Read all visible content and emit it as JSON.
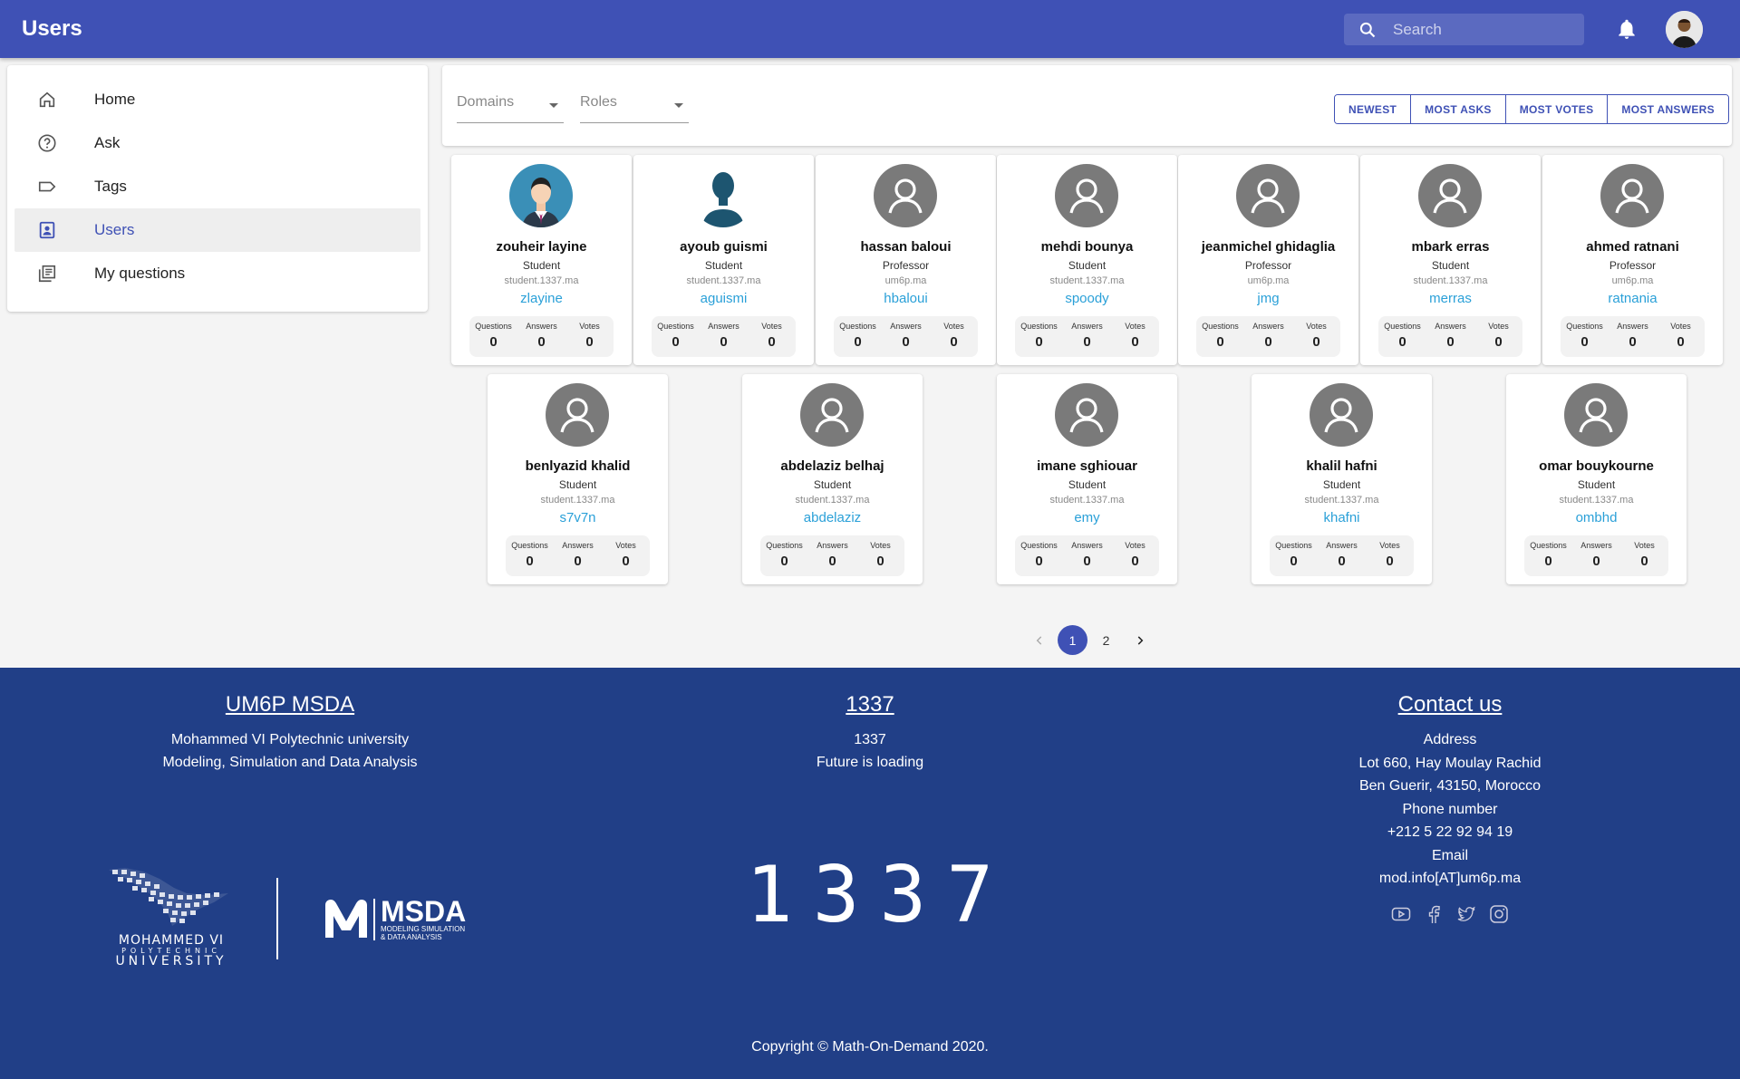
{
  "app": {
    "title": "Users"
  },
  "search": {
    "placeholder": "Search"
  },
  "sidebar": {
    "items": [
      {
        "label": "Home",
        "icon": "home-icon"
      },
      {
        "label": "Ask",
        "icon": "help-circle-icon"
      },
      {
        "label": "Tags",
        "icon": "label-icon"
      },
      {
        "label": "Users",
        "icon": "contact-card-icon",
        "active": true
      },
      {
        "label": "My questions",
        "icon": "library-books-icon"
      }
    ]
  },
  "filters": {
    "domains": "Domains",
    "roles": "Roles"
  },
  "sort": {
    "newest": "NEWEST",
    "most_asks": "MOST ASKS",
    "most_votes": "MOST VOTES",
    "most_answers": "MOST ANSWERS"
  },
  "stat_labels": {
    "questions": "Questions",
    "answers": "Answers",
    "votes": "Votes"
  },
  "users": [
    {
      "name": "zouheir layine",
      "role": "Student",
      "domain": "student.1337.ma",
      "username": "zlayine",
      "questions": "0",
      "answers": "0",
      "votes": "0",
      "avatar": "man-in-suit-avatar"
    },
    {
      "name": "ayoub guismi",
      "role": "Student",
      "domain": "student.1337.ma",
      "username": "aguismi",
      "questions": "0",
      "answers": "0",
      "votes": "0",
      "avatar": "person-silhouette-avatar"
    },
    {
      "name": "hassan baloui",
      "role": "Professor",
      "domain": "um6p.ma",
      "username": "hbaloui",
      "questions": "0",
      "answers": "0",
      "votes": "0",
      "avatar": "generic-user-avatar"
    },
    {
      "name": "mehdi bounya",
      "role": "Student",
      "domain": "student.1337.ma",
      "username": "spoody",
      "questions": "0",
      "answers": "0",
      "votes": "0",
      "avatar": "generic-user-avatar"
    },
    {
      "name": "jeanmichel ghidaglia",
      "role": "Professor",
      "domain": "um6p.ma",
      "username": "jmg",
      "questions": "0",
      "answers": "0",
      "votes": "0",
      "avatar": "generic-user-avatar"
    },
    {
      "name": "mbark erras",
      "role": "Student",
      "domain": "student.1337.ma",
      "username": "merras",
      "questions": "0",
      "answers": "0",
      "votes": "0",
      "avatar": "generic-user-avatar"
    },
    {
      "name": "ahmed ratnani",
      "role": "Professor",
      "domain": "um6p.ma",
      "username": "ratnania",
      "questions": "0",
      "answers": "0",
      "votes": "0",
      "avatar": "generic-user-avatar"
    },
    {
      "name": "benlyazid khalid",
      "role": "Student",
      "domain": "student.1337.ma",
      "username": "s7v7n",
      "questions": "0",
      "answers": "0",
      "votes": "0",
      "avatar": "generic-user-avatar"
    },
    {
      "name": "abdelaziz belhaj",
      "role": "Student",
      "domain": "student.1337.ma",
      "username": "abdelaziz",
      "questions": "0",
      "answers": "0",
      "votes": "0",
      "avatar": "generic-user-avatar"
    },
    {
      "name": "imane sghiouar",
      "role": "Student",
      "domain": "student.1337.ma",
      "username": "emy",
      "questions": "0",
      "answers": "0",
      "votes": "0",
      "avatar": "generic-user-avatar"
    },
    {
      "name": "khalil hafni",
      "role": "Student",
      "domain": "student.1337.ma",
      "username": "khafni",
      "questions": "0",
      "answers": "0",
      "votes": "0",
      "avatar": "generic-user-avatar"
    },
    {
      "name": "omar bouykourne",
      "role": "Student",
      "domain": "student.1337.ma",
      "username": "ombhd",
      "questions": "0",
      "answers": "0",
      "votes": "0",
      "avatar": "generic-user-avatar"
    }
  ],
  "pagination": {
    "pages": [
      "1",
      "2"
    ],
    "current": "1"
  },
  "footer": {
    "col1": {
      "title": "UM6P MSDA",
      "line1": "Mohammed VI Polytechnic university",
      "line2": "Modeling, Simulation and Data Analysis"
    },
    "col2": {
      "title": "1337",
      "line1": "1337",
      "line2": "Future is loading"
    },
    "contact": {
      "title": "Contact us",
      "address_label": "Address",
      "address1": "Lot 660, Hay Moulay Rachid",
      "address2": "Ben Guerir, 43150, Morocco",
      "phone_label": "Phone number",
      "phone": "+212 5 22 92 94 19",
      "email_label": "Email",
      "email": "mod.info[AT]um6p.ma"
    },
    "logos": {
      "um6p_line1": "MOHAMMED VI",
      "um6p_line2": "POLYTECHNIC",
      "um6p_line3": "UNIVERSITY",
      "msda_title": "MSDA",
      "msda_sub1": "MODELING SIMULATION",
      "msda_sub2": "& DATA ANALYSIS",
      "logo_1337": "1337"
    },
    "copyright": "Copyright © Math-On-Demand 2020."
  }
}
